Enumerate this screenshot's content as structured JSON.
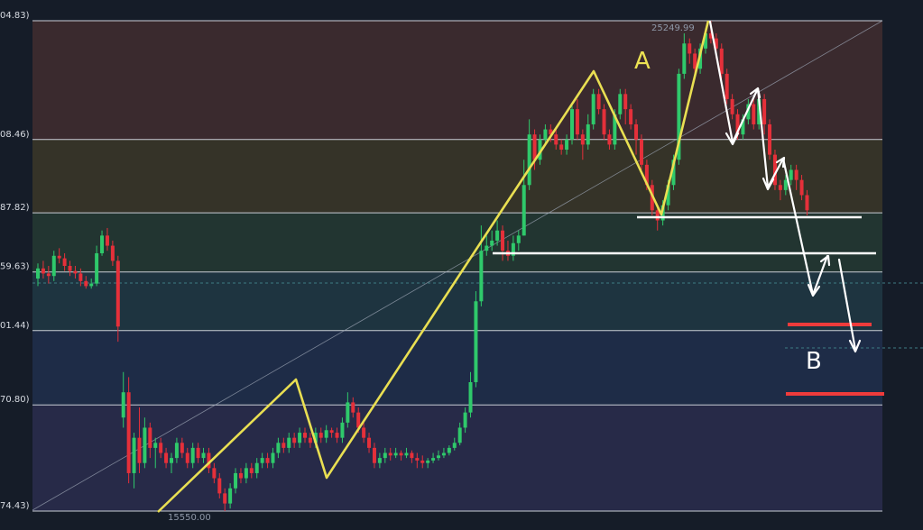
{
  "chart_data": {
    "type": "candlestick",
    "title": "",
    "xlabel": "",
    "ylabel": "",
    "ylim": [
      15450,
      25400
    ],
    "grid": false,
    "legend": "none",
    "fib_levels": [
      {
        "label": "04.83)",
        "value": 25249.99,
        "color": "#3a2a2e"
      },
      {
        "label": "08.46)",
        "value": 22900,
        "color": "#353328"
      },
      {
        "label": "87.82)",
        "value": 21450,
        "color": "#223531"
      },
      {
        "label": "59.63)",
        "value": 20280,
        "color": "#1e3440"
      },
      {
        "label": "01.44)",
        "value": 19120,
        "color": "#1e2c47"
      },
      {
        "label": "70.80)",
        "value": 17650,
        "color": "#272a48"
      },
      {
        "label": "74.43)",
        "value": 15550.0
      }
    ],
    "price_labels": {
      "high": "25249.99",
      "low": "15550.00"
    },
    "annotations": {
      "a": "A",
      "b": "B"
    },
    "candles": [
      [
        0,
        20150,
        20350,
        20450,
        20000
      ],
      [
        1,
        20350,
        20250,
        20500,
        20150
      ],
      [
        2,
        20250,
        20200,
        20400,
        20050
      ],
      [
        3,
        20200,
        20600,
        20700,
        20100
      ],
      [
        4,
        20600,
        20550,
        20750,
        20450
      ],
      [
        5,
        20550,
        20400,
        20650,
        20300
      ],
      [
        6,
        20400,
        20300,
        20500,
        20200
      ],
      [
        7,
        20300,
        20250,
        20400,
        20150
      ],
      [
        8,
        20250,
        20100,
        20350,
        20000
      ],
      [
        9,
        20100,
        20000,
        20200,
        19950
      ],
      [
        10,
        20000,
        20050,
        20150,
        19950
      ],
      [
        11,
        20050,
        20650,
        20800,
        20000
      ],
      [
        12,
        20650,
        21000,
        21100,
        20600
      ],
      [
        13,
        21000,
        20800,
        21150,
        20700
      ],
      [
        14,
        20800,
        20500,
        20900,
        20400
      ],
      [
        15,
        20500,
        19200,
        20600,
        18900
      ],
      [
        16,
        17400,
        17900,
        18300,
        17200
      ],
      [
        17,
        17900,
        16300,
        18200,
        16100
      ],
      [
        18,
        16300,
        17000,
        17100,
        16000
      ],
      [
        19,
        17000,
        16500,
        17600,
        16300
      ],
      [
        20,
        16500,
        17200,
        17400,
        16400
      ],
      [
        21,
        17200,
        16800,
        17300,
        16600
      ],
      [
        22,
        16800,
        16900,
        17000,
        16400
      ],
      [
        23,
        16900,
        16700,
        17000,
        16600
      ],
      [
        24,
        16700,
        16500,
        16800,
        16400
      ],
      [
        25,
        16500,
        16600,
        16700,
        16300
      ],
      [
        26,
        16600,
        16900,
        17000,
        16500
      ],
      [
        27,
        16900,
        16700,
        17000,
        16600
      ],
      [
        28,
        16700,
        16500,
        16800,
        16400
      ],
      [
        29,
        16500,
        16800,
        16900,
        16400
      ],
      [
        30,
        16800,
        16600,
        16900,
        16500
      ],
      [
        31,
        16600,
        16700,
        16800,
        16500
      ],
      [
        32,
        16700,
        16400,
        16800,
        16300
      ],
      [
        33,
        16400,
        16200,
        16500,
        16100
      ],
      [
        34,
        16200,
        15900,
        16300,
        15800
      ],
      [
        35,
        15900,
        15700,
        16000,
        15550
      ],
      [
        36,
        15700,
        16000,
        16100,
        15600
      ],
      [
        37,
        16000,
        16300,
        16400,
        15900
      ],
      [
        38,
        16300,
        16200,
        16400,
        16100
      ],
      [
        39,
        16200,
        16400,
        16500,
        16100
      ],
      [
        40,
        16400,
        16300,
        16500,
        16200
      ],
      [
        41,
        16300,
        16500,
        16600,
        16200
      ],
      [
        42,
        16500,
        16600,
        16700,
        16400
      ],
      [
        43,
        16600,
        16500,
        16700,
        16400
      ],
      [
        44,
        16500,
        16700,
        16800,
        16400
      ],
      [
        45,
        16700,
        16900,
        17000,
        16600
      ],
      [
        46,
        16900,
        16800,
        17000,
        16700
      ],
      [
        47,
        16800,
        17000,
        17100,
        16700
      ],
      [
        48,
        17000,
        16900,
        17100,
        16800
      ],
      [
        49,
        16900,
        17100,
        17200,
        16800
      ],
      [
        50,
        17100,
        17000,
        17200,
        16900
      ],
      [
        51,
        17000,
        16900,
        17100,
        16800
      ],
      [
        52,
        16900,
        17100,
        17200,
        16800
      ],
      [
        53,
        17100,
        17000,
        17200,
        16900
      ],
      [
        54,
        17000,
        17150,
        17250,
        16900
      ],
      [
        55,
        17150,
        17100,
        17200,
        17000
      ],
      [
        56,
        17100,
        17000,
        17200,
        16900
      ],
      [
        57,
        17000,
        17300,
        17400,
        16900
      ],
      [
        58,
        17300,
        17700,
        17900,
        17200
      ],
      [
        59,
        17700,
        17500,
        17800,
        17400
      ],
      [
        60,
        17500,
        17200,
        17600,
        17100
      ],
      [
        61,
        17200,
        17000,
        17300,
        16900
      ],
      [
        62,
        17000,
        16800,
        17100,
        16700
      ],
      [
        63,
        16800,
        16500,
        16900,
        16400
      ],
      [
        64,
        16500,
        16600,
        16700,
        16400
      ],
      [
        65,
        16600,
        16700,
        16800,
        16500
      ],
      [
        66,
        16700,
        16650,
        16800,
        16550
      ],
      [
        67,
        16650,
        16700,
        16800,
        16600
      ],
      [
        68,
        16700,
        16650,
        16750,
        16550
      ],
      [
        69,
        16650,
        16700,
        16800,
        16600
      ],
      [
        70,
        16700,
        16600,
        16750,
        16500
      ],
      [
        71,
        16600,
        16550,
        16700,
        16400
      ],
      [
        72,
        16550,
        16500,
        16650,
        16400
      ],
      [
        73,
        16500,
        16550,
        16600,
        16400
      ],
      [
        74,
        16550,
        16600,
        16700,
        16500
      ],
      [
        75,
        16600,
        16650,
        16750,
        16550
      ],
      [
        76,
        16650,
        16700,
        16800,
        16600
      ],
      [
        77,
        16700,
        16800,
        16850,
        16650
      ],
      [
        78,
        16800,
        16900,
        17000,
        16750
      ],
      [
        79,
        16900,
        17200,
        17300,
        16850
      ],
      [
        80,
        17200,
        17500,
        17600,
        17100
      ],
      [
        81,
        17500,
        18100,
        18300,
        17400
      ],
      [
        82,
        18100,
        19700,
        19900,
        18000
      ],
      [
        83,
        19700,
        20700,
        21200,
        19600
      ],
      [
        84,
        20700,
        20800,
        21000,
        20600
      ],
      [
        85,
        20800,
        20900,
        21100,
        20700
      ],
      [
        86,
        20900,
        21100,
        21300,
        20800
      ],
      [
        87,
        21100,
        20700,
        21200,
        20500
      ],
      [
        88,
        20700,
        20600,
        20900,
        20500
      ],
      [
        89,
        20600,
        20850,
        21000,
        20500
      ],
      [
        90,
        20850,
        21000,
        21100,
        20700
      ],
      [
        91,
        21000,
        22000,
        22500,
        21000
      ],
      [
        92,
        22000,
        23000,
        23300,
        21900
      ],
      [
        93,
        23000,
        22500,
        23100,
        22300
      ],
      [
        94,
        22500,
        22900,
        23000,
        22400
      ],
      [
        95,
        22900,
        23100,
        23200,
        22800
      ],
      [
        96,
        23100,
        23000,
        23200,
        22850
      ],
      [
        97,
        23000,
        22800,
        23100,
        22700
      ],
      [
        98,
        22800,
        22700,
        22900,
        22600
      ],
      [
        99,
        22700,
        22900,
        23000,
        22600
      ],
      [
        100,
        22900,
        23500,
        23600,
        22800
      ],
      [
        101,
        23500,
        23000,
        23700,
        22900
      ],
      [
        102,
        23000,
        22800,
        23100,
        22500
      ],
      [
        103,
        22800,
        23200,
        23400,
        22700
      ],
      [
        104,
        23200,
        23800,
        23900,
        23100
      ],
      [
        105,
        23800,
        23500,
        23900,
        23400
      ],
      [
        106,
        23500,
        23000,
        23600,
        22900
      ],
      [
        107,
        23000,
        22800,
        23100,
        22700
      ],
      [
        108,
        22800,
        23400,
        23500,
        22700
      ],
      [
        109,
        23400,
        23800,
        23900,
        23300
      ],
      [
        110,
        23800,
        23500,
        23900,
        23200
      ],
      [
        111,
        23500,
        23200,
        23600,
        23100
      ],
      [
        112,
        23200,
        22900,
        23300,
        22600
      ],
      [
        113,
        22900,
        22400,
        23000,
        22300
      ],
      [
        114,
        22400,
        22000,
        22500,
        21900
      ],
      [
        115,
        22000,
        21500,
        22100,
        21400
      ],
      [
        116,
        21500,
        21300,
        21600,
        21100
      ],
      [
        117,
        21300,
        21600,
        21700,
        21200
      ],
      [
        118,
        21600,
        22000,
        22100,
        21500
      ],
      [
        119,
        22000,
        22500,
        22600,
        21900
      ],
      [
        120,
        22500,
        24200,
        24300,
        22400
      ],
      [
        121,
        24200,
        24800,
        25000,
        24100
      ],
      [
        122,
        24800,
        24600,
        24900,
        24400
      ],
      [
        123,
        24600,
        24300,
        24700,
        24200
      ],
      [
        124,
        24300,
        24700,
        24800,
        24200
      ],
      [
        125,
        24700,
        25000,
        25100,
        24600
      ],
      [
        126,
        25000,
        24900,
        25249.99,
        24800
      ],
      [
        127,
        24900,
        24700,
        25000,
        24500
      ],
      [
        128,
        24700,
        24200,
        24800,
        24100
      ],
      [
        129,
        24200,
        23700,
        24300,
        23600
      ],
      [
        130,
        23700,
        23400,
        23800,
        23300
      ],
      [
        131,
        23400,
        23000,
        23500,
        22900
      ],
      [
        132,
        23000,
        23300,
        23400,
        22900
      ],
      [
        133,
        23300,
        23600,
        23700,
        23200
      ],
      [
        134,
        23600,
        23200,
        23700,
        23100
      ],
      [
        135,
        23200,
        23700,
        23800,
        23100
      ],
      [
        136,
        23700,
        23200,
        23800,
        23000
      ],
      [
        137,
        23200,
        22600,
        23300,
        22500
      ],
      [
        138,
        22600,
        22000,
        22700,
        21900
      ],
      [
        139,
        22000,
        21900,
        22100,
        21700
      ],
      [
        140,
        21900,
        22100,
        22200,
        21800
      ],
      [
        141,
        22100,
        22300,
        22400,
        22000
      ],
      [
        142,
        22300,
        22100,
        22400,
        21900
      ],
      [
        143,
        22100,
        21800,
        22200,
        21700
      ],
      [
        144,
        21800,
        21500,
        21900,
        21400
      ]
    ]
  }
}
